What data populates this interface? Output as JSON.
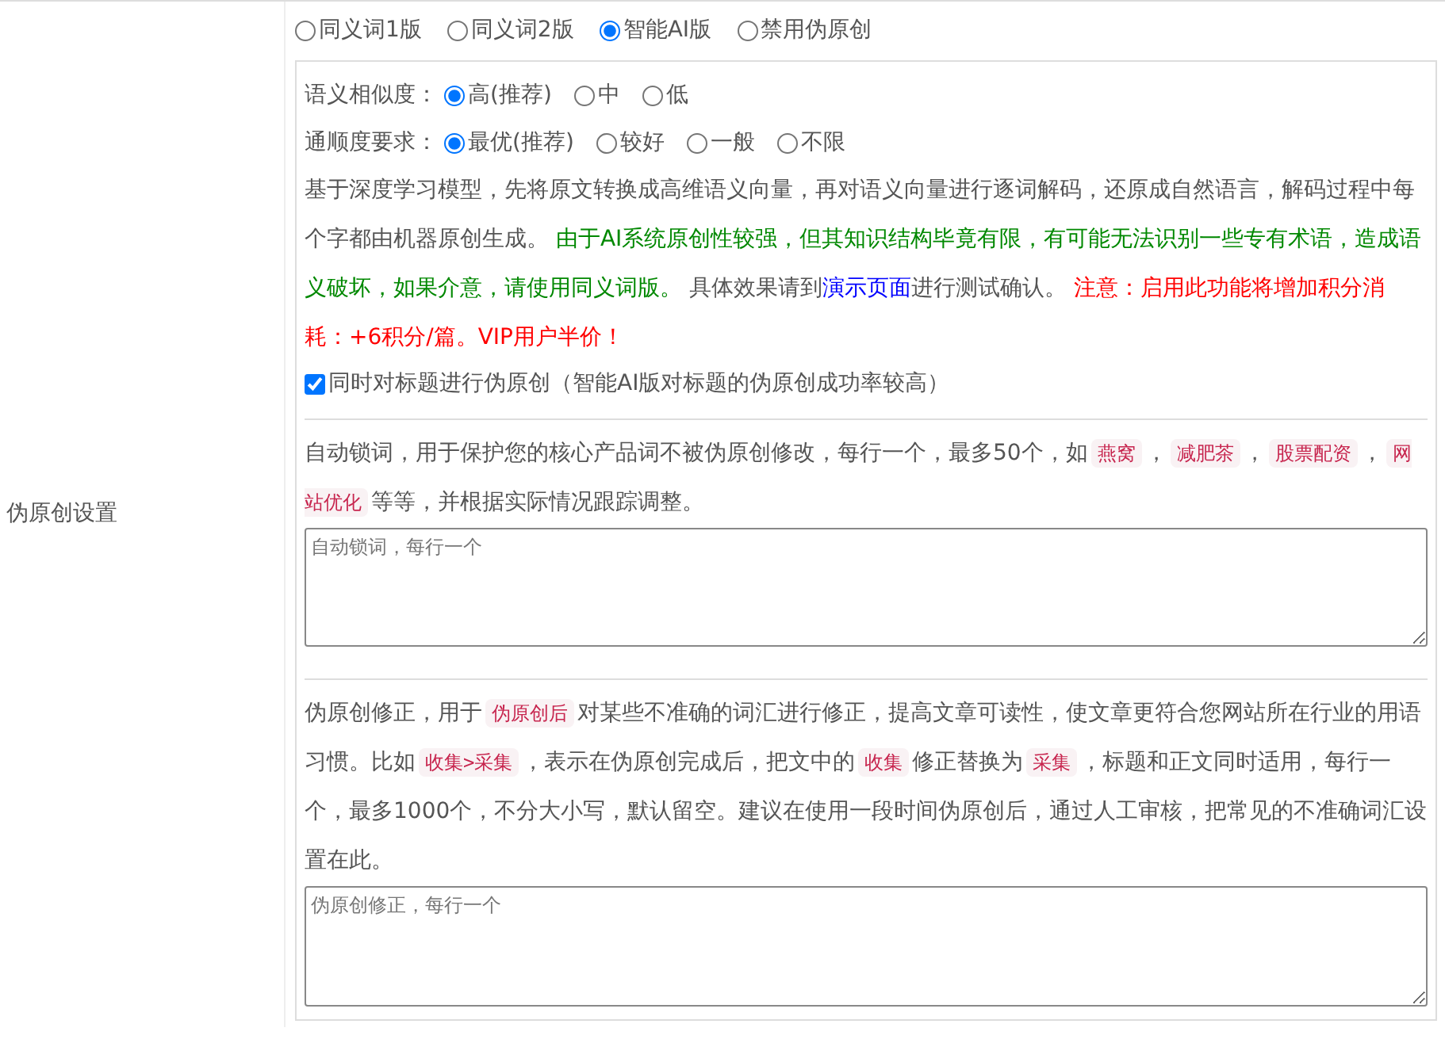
{
  "section_label": "伪原创设置",
  "modes": [
    {
      "label": "同义词1版",
      "selected": false
    },
    {
      "label": "同义词2版",
      "selected": false
    },
    {
      "label": "智能AI版",
      "selected": true
    },
    {
      "label": "禁用伪原创",
      "selected": false
    }
  ],
  "options": [
    {
      "label": "语义相似度：",
      "choices": [
        {
          "label": "高(推荐)",
          "selected": true
        },
        {
          "label": "中",
          "selected": false
        },
        {
          "label": "低",
          "selected": false
        }
      ]
    },
    {
      "label": "通顺度要求：",
      "choices": [
        {
          "label": "最优(推荐)",
          "selected": true
        },
        {
          "label": "较好",
          "selected": false
        },
        {
          "label": "一般",
          "selected": false
        },
        {
          "label": "不限",
          "selected": false
        }
      ]
    }
  ],
  "description": [
    {
      "kind": "plain",
      "text": "基于深度学习模型，先将原文转换成高维语义向量，再对语义向量进行逐词解码，还原成自然语言，解码过程中每个字都由机器原创生成。 "
    },
    {
      "kind": "green",
      "text": "由于AI系统原创性较强，但其知识结构毕竟有限，有可能无法识别一些专有术语，造成语义破坏，如果介意，请使用同义词版。"
    },
    {
      "kind": "plain",
      "text": " 具体效果请到"
    },
    {
      "kind": "link",
      "text": "演示页面"
    },
    {
      "kind": "plain",
      "text": "进行测试确认。 "
    },
    {
      "kind": "red",
      "text": "注意：启用此功能将增加积分消耗：+6积分/篇。VIP用户半价！"
    }
  ],
  "title_option": {
    "label": "同时对标题进行伪原创（智能AI版对标题的伪原创成功率较高）",
    "checked": true
  },
  "lock_words": {
    "description": [
      {
        "kind": "plain",
        "text": "自动锁词，用于保护您的核心产品词不被伪原创修改，每行一个，最多50个，如"
      },
      {
        "kind": "code",
        "text": "燕窝"
      },
      {
        "kind": "plain",
        "text": "，"
      },
      {
        "kind": "code",
        "text": "减肥茶"
      },
      {
        "kind": "plain",
        "text": "，"
      },
      {
        "kind": "code",
        "text": "股票配资"
      },
      {
        "kind": "plain",
        "text": "，"
      },
      {
        "kind": "code",
        "text": "网站优化"
      },
      {
        "kind": "plain",
        "text": "等等，并根据实际情况跟踪调整。"
      }
    ],
    "placeholder": "自动锁词，每行一个"
  },
  "corrections": {
    "description": [
      {
        "kind": "plain",
        "text": "伪原创修正，用于"
      },
      {
        "kind": "code",
        "text": "伪原创后"
      },
      {
        "kind": "plain",
        "text": "对某些不准确的词汇进行修正，提高文章可读性，使文章更符合您网站所在行业的用语习惯。比如"
      },
      {
        "kind": "code",
        "text": "收集>采集"
      },
      {
        "kind": "plain",
        "text": "，表示在伪原创完成后，把文中的"
      },
      {
        "kind": "code",
        "text": "收集"
      },
      {
        "kind": "plain",
        "text": "修正替换为"
      },
      {
        "kind": "code",
        "text": "采集"
      },
      {
        "kind": "plain",
        "text": "，标题和正文同时适用，每行一个，最多1000个，不分大小写，默认留空。建议在使用一段时间伪原创后，通过人工审核，把常见的不准确词汇设置在此。"
      }
    ],
    "placeholder": "伪原创修正，每行一个"
  }
}
